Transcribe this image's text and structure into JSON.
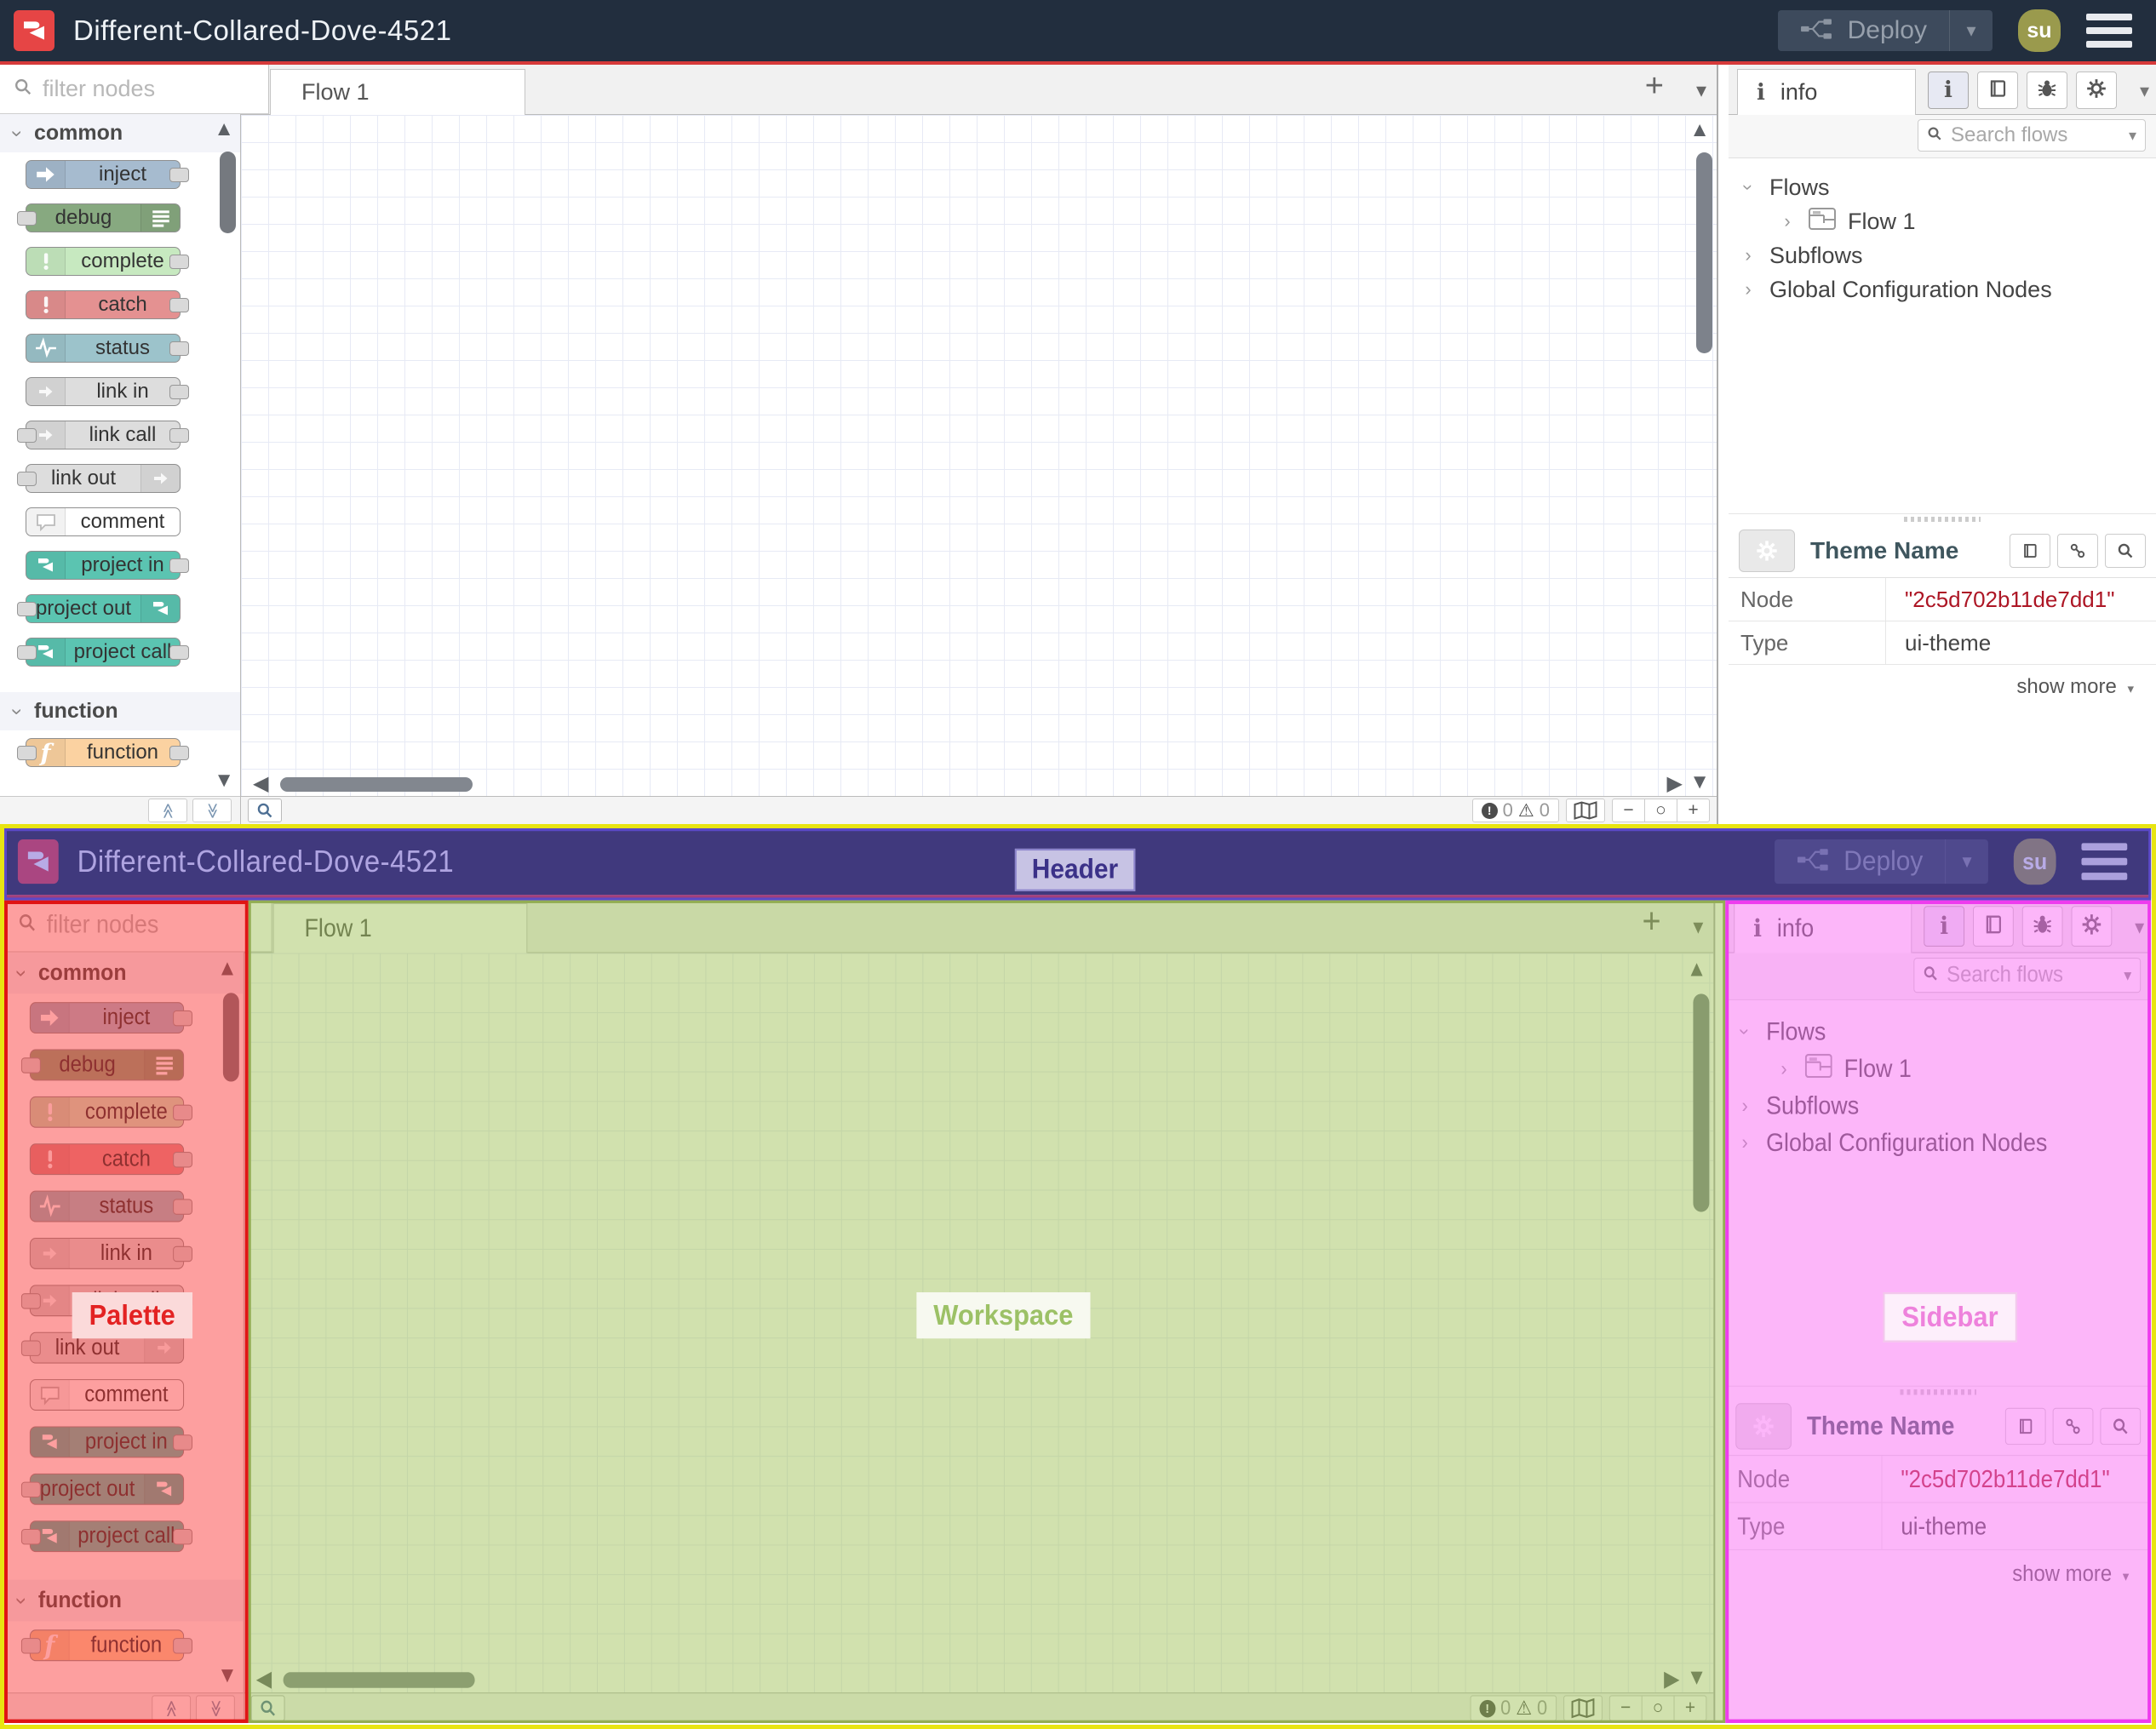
{
  "header": {
    "title": "Different-Collared-Dove-4521",
    "deploy_label": "Deploy",
    "avatar_initials": "su"
  },
  "palette": {
    "filter_placeholder": "filter nodes",
    "categories": [
      {
        "label": "common",
        "nodes": [
          {
            "label": "inject",
            "color": "#a6bbcf",
            "icon": "arrow-in-icon",
            "icon_side": "left",
            "ports": "right"
          },
          {
            "label": "debug",
            "color": "#87a980",
            "icon": "list-icon",
            "icon_side": "right",
            "ports": "left"
          },
          {
            "label": "complete",
            "color": "#c7e9c0",
            "icon": "exclamation-icon",
            "icon_side": "left",
            "ports": "right"
          },
          {
            "label": "catch",
            "color": "#e49191",
            "icon": "exclamation-icon",
            "icon_side": "left",
            "ports": "right"
          },
          {
            "label": "status",
            "color": "#9cc3cb",
            "icon": "pulse-icon",
            "icon_side": "left",
            "ports": "right"
          },
          {
            "label": "link in",
            "color": "#dddddd",
            "icon": "link-arrow-icon",
            "icon_side": "left",
            "ports": "right"
          },
          {
            "label": "link call",
            "color": "#dddddd",
            "icon": "link-arrow-icon",
            "icon_side": "left",
            "ports": "both"
          },
          {
            "label": "link out",
            "color": "#dddddd",
            "icon": "link-arrow-icon",
            "icon_side": "right",
            "ports": "left"
          },
          {
            "label": "comment",
            "color": "#ffffff",
            "icon": "comment-icon",
            "icon_side": "left",
            "ports": "none"
          },
          {
            "label": "project in",
            "color": "#5bc4b1",
            "icon": "project-icon",
            "icon_side": "left",
            "ports": "right"
          },
          {
            "label": "project out",
            "color": "#5bc4b1",
            "icon": "project-icon",
            "icon_side": "right",
            "ports": "left"
          },
          {
            "label": "project call",
            "color": "#5bc4b1",
            "icon": "project-icon",
            "icon_side": "left",
            "ports": "both"
          }
        ]
      },
      {
        "label": "function",
        "nodes": [
          {
            "label": "function",
            "color": "#fbd2a1",
            "icon": "function-icon",
            "icon_side": "left",
            "ports": "both"
          }
        ]
      }
    ]
  },
  "workspace": {
    "tab_label": "Flow 1",
    "add_tab_label": "+",
    "footer": {
      "error_count": "0",
      "warning_count": "0",
      "zoom_out_label": "−",
      "zoom_reset_label": "○",
      "zoom_in_label": "+"
    }
  },
  "sidebar": {
    "tab_label": "info",
    "search_placeholder": "Search flows",
    "tree": {
      "flows_label": "Flows",
      "flow1_label": "Flow 1",
      "subflows_label": "Subflows",
      "global_label": "Global Configuration Nodes"
    },
    "panel": {
      "title": "Theme Name",
      "rows": [
        {
          "key": "Node",
          "value": "\"2c5d702b11de7dd1\"",
          "accent": true
        },
        {
          "key": "Type",
          "value": "ui-theme",
          "accent": false
        }
      ],
      "show_more_label": "show more"
    }
  },
  "annotations": {
    "header_label": "Header",
    "palette_label": "Palette",
    "workspace_label": "Workspace",
    "sidebar_label": "Sidebar"
  },
  "colors": {
    "header_bg": "#222e3e",
    "header_underline_red": "#d63a3a",
    "node_red_brand": "#e64545",
    "node_id_red": "#ad1625",
    "annotation_yellow": "#e8e411",
    "annotation_red": "#e01414",
    "annotation_green": "#93ad53",
    "annotation_magenta": "#ee3cee",
    "annotation_purple": "#5b49c8"
  }
}
